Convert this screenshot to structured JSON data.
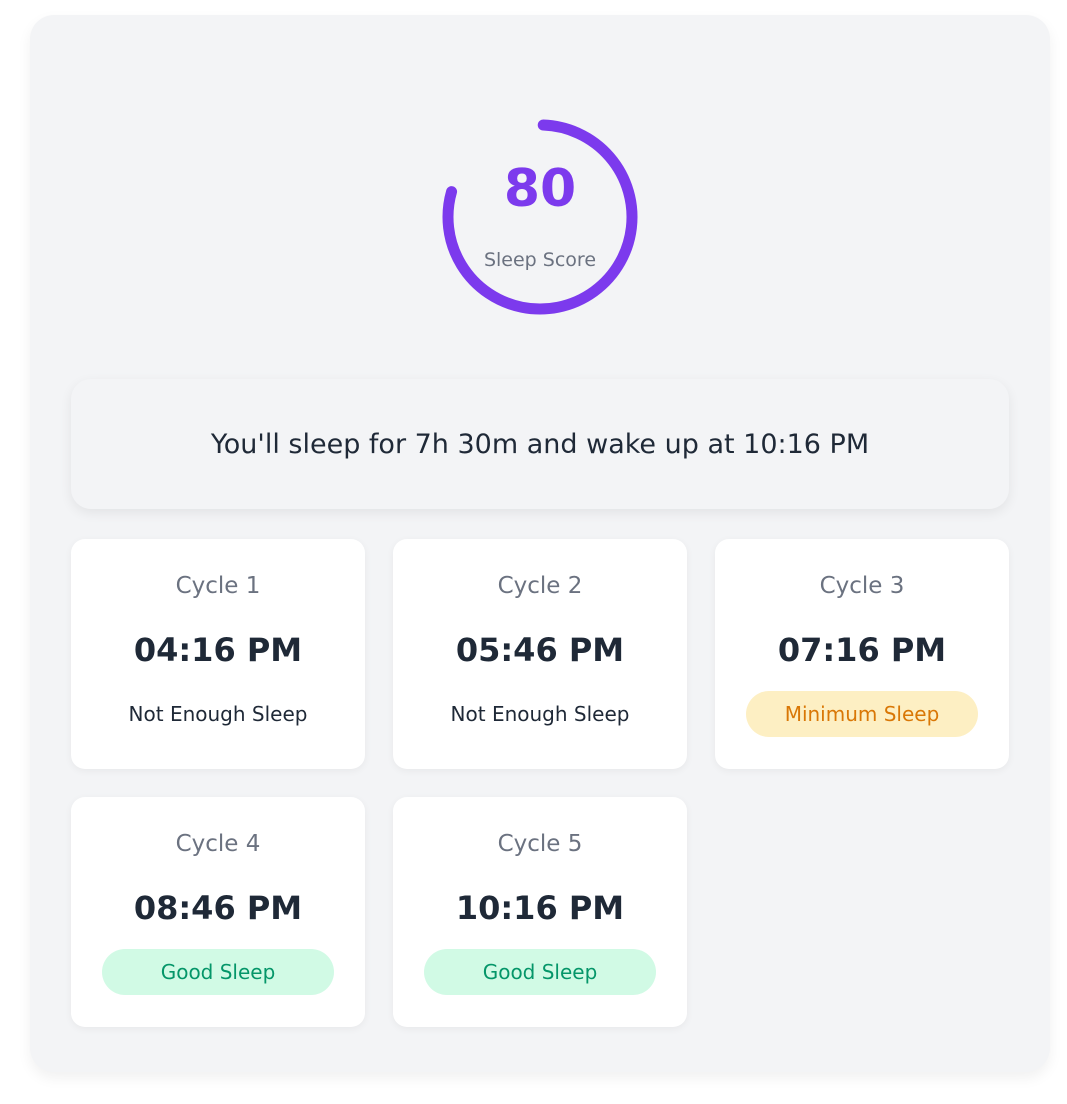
{
  "score": {
    "value": "80",
    "label": "Sleep Score",
    "fraction": 0.8,
    "color": "#7c3aed"
  },
  "summary": "You'll sleep for 7h 30m and wake up at 10:16 PM",
  "cycles": [
    {
      "label": "Cycle 1",
      "time": "04:16 PM",
      "status": "Not Enough Sleep",
      "kind": "none"
    },
    {
      "label": "Cycle 2",
      "time": "05:46 PM",
      "status": "Not Enough Sleep",
      "kind": "none"
    },
    {
      "label": "Cycle 3",
      "time": "07:16 PM",
      "status": "Minimum Sleep",
      "kind": "minimum"
    },
    {
      "label": "Cycle 4",
      "time": "08:46 PM",
      "status": "Good Sleep",
      "kind": "good"
    },
    {
      "label": "Cycle 5",
      "time": "10:16 PM",
      "status": "Good Sleep",
      "kind": "good"
    }
  ],
  "colors": {
    "minimum_bg": "#fdefc3",
    "minimum_text": "#d97706",
    "good_bg": "#d1fae5",
    "good_text": "#059669"
  }
}
